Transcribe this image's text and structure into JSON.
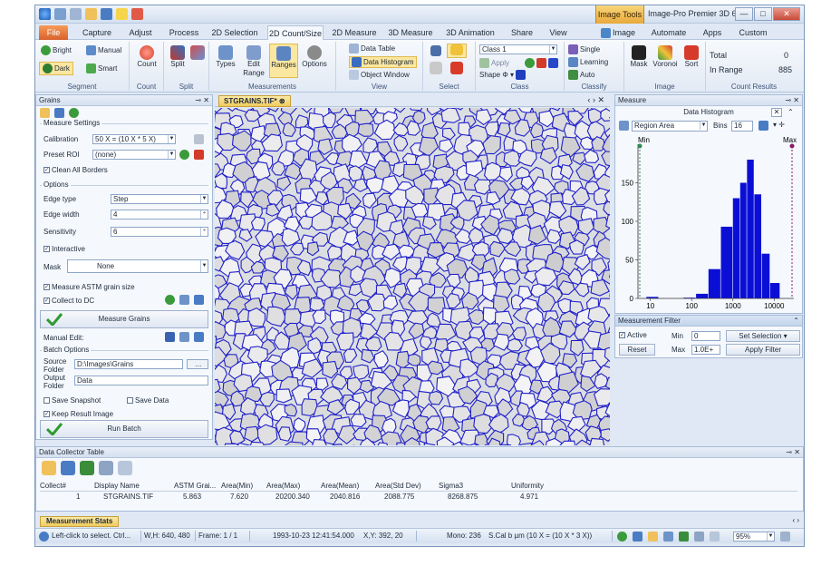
{
  "window": {
    "title": "Image-Pro Premier 3D 6...",
    "context_tab": "Image Tools",
    "minimize": "—",
    "maximize": "□",
    "close": "✕"
  },
  "tabs": [
    {
      "label": "File"
    },
    {
      "label": "Capture"
    },
    {
      "label": "Adjust"
    },
    {
      "label": "Process"
    },
    {
      "label": "2D Selection"
    },
    {
      "label": "2D Count/Size"
    },
    {
      "label": "2D Measure"
    },
    {
      "label": "3D Measure"
    },
    {
      "label": "3D Animation"
    },
    {
      "label": "Share"
    },
    {
      "label": "View"
    },
    {
      "label": "Image"
    },
    {
      "label": "Automate"
    },
    {
      "label": "Apps"
    },
    {
      "label": "Custom"
    }
  ],
  "ribbon": {
    "segment": {
      "label": "Segment",
      "bright": "Bright",
      "manual": "Manual",
      "dark": "Dark",
      "smart": "Smart"
    },
    "count": {
      "label": "Count",
      "count_btn": "Count"
    },
    "split": {
      "label": "Split",
      "split_btn": "Split"
    },
    "measurements": {
      "label": "Measurements",
      "types": "Types",
      "edit_range": "Edit Range",
      "ranges": "Ranges",
      "options": "Options"
    },
    "view": {
      "label": "View",
      "data_table": "Data Table",
      "data_histogram": "Data Histogram",
      "object_window": "Object Window"
    },
    "select": {
      "label": "Select"
    },
    "class": {
      "label": "Class",
      "class_value": "Class 1",
      "apply": "Apply",
      "shape": "Shape"
    },
    "classify": {
      "label": "Classify",
      "single": "Single",
      "learning": "Learning",
      "auto": "Auto"
    },
    "image": {
      "label": "Image",
      "mask": "Mask",
      "voronoi": "Voronoi",
      "sort": "Sort"
    },
    "count_results": {
      "label": "Count Results",
      "total_label": "Total",
      "total_value": "0",
      "in_range_label": "In Range",
      "in_range_value": "885"
    }
  },
  "grains_panel": {
    "title": "Grains",
    "measure_settings": "Measure Settings",
    "calibration_label": "Calibration",
    "calibration_value": "50 X = (10 X * 5 X)",
    "preset_roi_label": "Preset ROI",
    "preset_roi_value": "(none)",
    "clean_borders": "Clean All Borders",
    "options": "Options",
    "edge_type_label": "Edge type",
    "edge_type_value": "Step",
    "edge_width_label": "Edge width",
    "edge_width_value": "4",
    "sensitivity_label": "Sensitivity",
    "sensitivity_value": "6",
    "interactive": "Interactive",
    "mask_label": "Mask",
    "mask_value": "None",
    "measure_astm": "Measure ASTM grain size",
    "collect_dc": "Collect to DC",
    "measure_grains_btn": "Measure Grains",
    "manual_edit": "Manual Edit:",
    "batch_options": "Batch Options",
    "source_folder_label": "Source Folder",
    "source_folder_value": "D:\\Images\\Grains",
    "browse": "...",
    "output_folder_label": "Output Folder",
    "output_folder_value": "Data",
    "save_snapshot": "Save Snapshot",
    "save_data": "Save Data",
    "keep_result": "Keep Result Image",
    "run_batch_btn": "Run Batch"
  },
  "document": {
    "tab_label": "STGRAINS.TIF*",
    "nav_prev": "‹",
    "nav_next": "›",
    "close": "✕"
  },
  "measure_panel": {
    "title": "Measure",
    "histogram_title": "Data Histogram",
    "measure_select": "Region Area",
    "bins_label": "Bins",
    "bins_value": "16",
    "min_label": "Min",
    "max_label": "Max"
  },
  "chart_data": {
    "type": "bar",
    "title": "Data Histogram",
    "xscale": "log",
    "xlim": [
      5,
      30000
    ],
    "ylim": [
      0,
      200
    ],
    "yticks": [
      0,
      50,
      100,
      150
    ],
    "xticks": [
      10,
      100,
      1000,
      10000
    ],
    "bins": [
      {
        "from": 8,
        "to": 16,
        "value": 2
      },
      {
        "from": 16,
        "to": 32,
        "value": 0
      },
      {
        "from": 32,
        "to": 64,
        "value": 0
      },
      {
        "from": 64,
        "to": 128,
        "value": 1
      },
      {
        "from": 128,
        "to": 256,
        "value": 6
      },
      {
        "from": 256,
        "to": 512,
        "value": 38
      },
      {
        "from": 512,
        "to": 1000,
        "value": 93
      },
      {
        "from": 1000,
        "to": 1500,
        "value": 130
      },
      {
        "from": 1500,
        "to": 2200,
        "value": 150
      },
      {
        "from": 2200,
        "to": 3300,
        "value": 180
      },
      {
        "from": 3300,
        "to": 5000,
        "value": 135
      },
      {
        "from": 5000,
        "to": 8000,
        "value": 58
      },
      {
        "from": 8000,
        "to": 14000,
        "value": 20
      }
    ]
  },
  "filter_panel": {
    "title": "Measurement Filter",
    "active": "Active",
    "min_label": "Min",
    "min_value": "0",
    "max_label": "Max",
    "max_value": "1.0E+",
    "set_selection": "Set Selection",
    "reset": "Reset",
    "apply_filter": "Apply Filter"
  },
  "data_collector": {
    "title": "Data Collector Table",
    "columns": [
      "Collect#",
      "Display Name",
      "ASTM Grai...",
      "Area(Min)",
      "Area(Max)",
      "Area(Mean)",
      "Area(Std Dev)",
      "Sigma3",
      "Uniformity"
    ],
    "rows": [
      [
        "1",
        "STGRAINS.TIF",
        "5.863",
        "7.620",
        "20200.340",
        "2040.816",
        "2088.775",
        "8268.875",
        "4.971"
      ]
    ],
    "bottom_tab": "Measurement Stats"
  },
  "status": {
    "hint": "Left-click to select. Ctrl...",
    "wh": "W,H: 640, 480",
    "frame": "Frame: 1 / 1",
    "datetime": "1993-10-23 12:41:54.000",
    "xy": "X,Y: 392, 20",
    "mono": "Mono: 236",
    "calib": "S.Cal b µm (10 X = (10 X * 3 X))",
    "zoom": "95%"
  }
}
